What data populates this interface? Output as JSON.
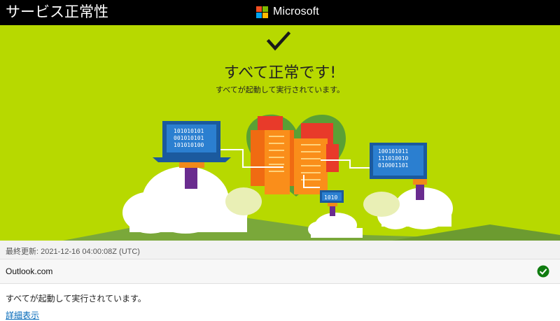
{
  "header": {
    "title": "サービス正常性",
    "brand": "Microsoft",
    "logo_colors": [
      "#f25022",
      "#7fba00",
      "#00a4ef",
      "#ffb900"
    ]
  },
  "hero": {
    "background": "#b7d900",
    "icon": "checkmark-icon",
    "headline": "すべて正常です!",
    "subline": "すべてが起動して実行されています。",
    "screen_codes": {
      "left": [
        "101010101",
        "001010101",
        "101010100"
      ],
      "right": [
        "100101011",
        "111010010",
        "010001101"
      ],
      "small": "1010"
    }
  },
  "last_updated": "最終更新: 2021-12-16 04:00:08Z (UTC)",
  "services": [
    {
      "name": "Outlook.com",
      "status_icon": "check-circle-icon",
      "status_color": "#107c10"
    }
  ],
  "status_text": "すべてが起動して実行されています。",
  "details_link": "詳細表示"
}
